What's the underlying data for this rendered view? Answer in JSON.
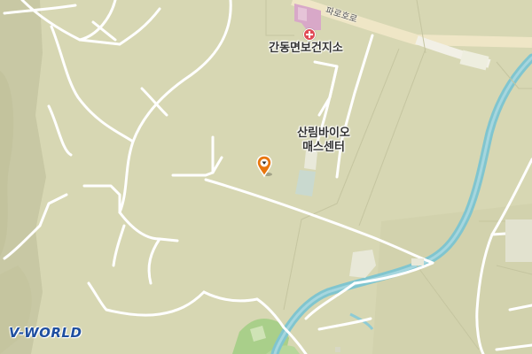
{
  "map": {
    "labels": {
      "health_center": "간동면보건지소",
      "bio_center": "산림바이오\n매스센터",
      "road": "파로호로"
    },
    "markers": {
      "pin_icon": "map-pin-icon",
      "hospital_icon": "hospital-cross-icon",
      "pin_color": "#e8760e",
      "hospital_color": "#e04b55"
    },
    "logo": "V-WORLD",
    "colors": {
      "land": "#d6d6b2",
      "road": "#ffffff",
      "river": "#7ec7d2",
      "green": "#a9cf8a",
      "building": "#eaeadb"
    }
  }
}
